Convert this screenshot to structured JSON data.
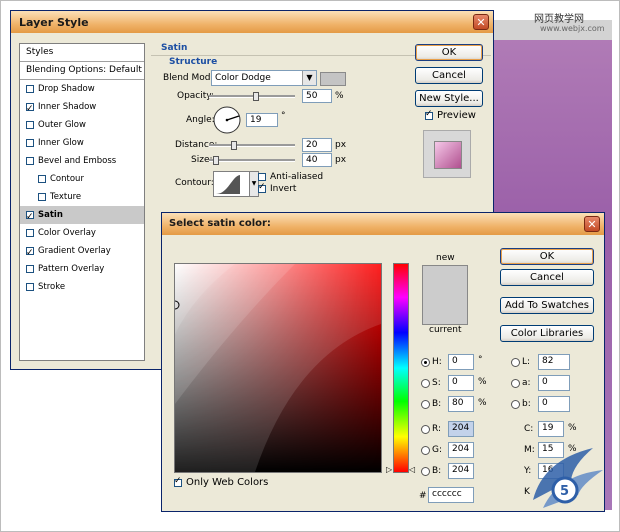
{
  "watermark": {
    "line1": "网页教学网",
    "line2": "www.webjx.com"
  },
  "layer_style": {
    "title": "Layer Style",
    "sidebar": {
      "header": "Styles",
      "blending": "Blending Options: Default",
      "items": [
        {
          "label": "Drop Shadow",
          "checked": false,
          "indent": false,
          "selected": false
        },
        {
          "label": "Inner Shadow",
          "checked": true,
          "indent": false,
          "selected": false
        },
        {
          "label": "Outer Glow",
          "checked": false,
          "indent": false,
          "selected": false
        },
        {
          "label": "Inner Glow",
          "checked": false,
          "indent": false,
          "selected": false
        },
        {
          "label": "Bevel and Emboss",
          "checked": false,
          "indent": false,
          "selected": false
        },
        {
          "label": "Contour",
          "checked": false,
          "indent": true,
          "selected": false
        },
        {
          "label": "Texture",
          "checked": false,
          "indent": true,
          "selected": false
        },
        {
          "label": "Satin",
          "checked": true,
          "indent": false,
          "selected": true
        },
        {
          "label": "Color Overlay",
          "checked": false,
          "indent": false,
          "selected": false
        },
        {
          "label": "Gradient Overlay",
          "checked": true,
          "indent": false,
          "selected": false
        },
        {
          "label": "Pattern Overlay",
          "checked": false,
          "indent": false,
          "selected": false
        },
        {
          "label": "Stroke",
          "checked": false,
          "indent": false,
          "selected": false
        }
      ]
    },
    "section_title": "Satin",
    "structure_title": "Structure",
    "blend_mode_label": "Blend Mode:",
    "blend_mode_value": "Color Dodge",
    "opacity_label": "Opacity:",
    "opacity_value": "50",
    "opacity_unit": "%",
    "angle_label": "Angle:",
    "angle_value": "19",
    "angle_unit": "°",
    "distance_label": "Distance:",
    "distance_value": "20",
    "distance_unit": "px",
    "size_label": "Size:",
    "size_value": "40",
    "size_unit": "px",
    "contour_label": "Contour:",
    "anti_aliased_label": "Anti-aliased",
    "anti_aliased": false,
    "invert_label": "Invert",
    "invert": true,
    "ok_label": "OK",
    "cancel_label": "Cancel",
    "new_style_label": "New Style...",
    "preview_label": "Preview",
    "preview": true
  },
  "color_picker": {
    "title": "Select satin color:",
    "new_label": "new",
    "current_label": "current",
    "ok_label": "OK",
    "cancel_label": "Cancel",
    "add_swatches_label": "Add To Swatches",
    "color_libraries_label": "Color Libraries",
    "only_web_colors_label": "Only Web Colors",
    "only_web_colors": true,
    "new_color": "#cccccc",
    "h_label": "H:",
    "h_value": "0",
    "h_unit": "°",
    "s_label": "S:",
    "s_value": "0",
    "s_unit": "%",
    "b_label": "B:",
    "b_value": "80",
    "b_unit": "%",
    "r_label": "R:",
    "r_value": "204",
    "g_label": "G:",
    "g_value": "204",
    "bl_label": "B:",
    "bl_value": "204",
    "l_label": "L:",
    "l_value": "82",
    "a_label": "a:",
    "a_value": "0",
    "b2_label": "b:",
    "b2_value": "0",
    "c_label": "C:",
    "c_value": "19",
    "c_unit": "%",
    "m_label": "M:",
    "m_value": "15",
    "m_unit": "%",
    "y_label": "Y:",
    "y_value": "16",
    "k_label": "K",
    "hex_label": "#",
    "hex_value": "cccccc"
  }
}
